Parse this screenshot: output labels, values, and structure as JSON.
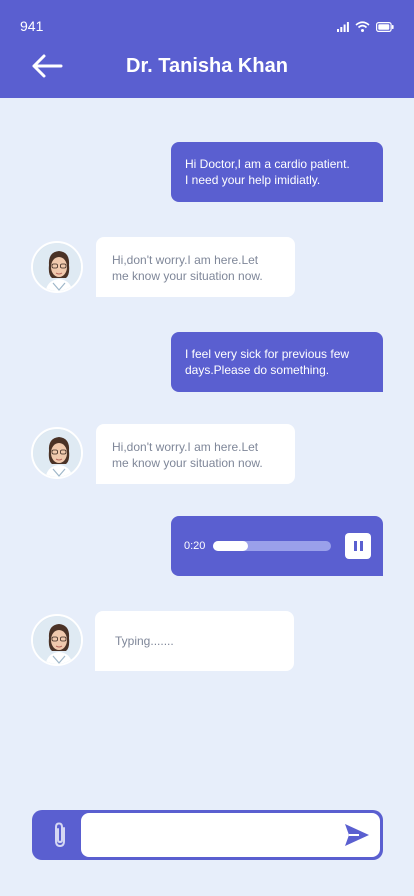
{
  "status": {
    "time": "941"
  },
  "header": {
    "title": "Dr. Tanisha Khan"
  },
  "icons": {
    "back": "arrow-left-icon",
    "signal": "signal-icon",
    "wifi": "wifi-icon",
    "battery": "battery-icon",
    "pause": "pause-icon",
    "attach": "paperclip-icon",
    "send": "send-icon",
    "avatar": "doctor-avatar"
  },
  "messages": [
    {
      "from": "me",
      "text": "Hi Doctor,I am a cardio patient.\nI need your help imidiatly."
    },
    {
      "from": "doctor",
      "text": "Hi,don't worry.I am here.Let\nme know your situation now."
    },
    {
      "from": "me",
      "text": "I feel very sick for previous few\ndays.Please do something."
    },
    {
      "from": "doctor",
      "text": "Hi,don't worry.I am here.Let\nme know your situation now."
    },
    {
      "from": "me",
      "type": "voice",
      "time": "0:20",
      "progress": 0.3
    },
    {
      "from": "doctor",
      "text": "Typing......."
    }
  ],
  "composer": {
    "value": "",
    "placeholder": ""
  },
  "colors": {
    "primary": "#5a5fd0",
    "background": "#e7eefa",
    "incoming_text": "#7f8799"
  }
}
